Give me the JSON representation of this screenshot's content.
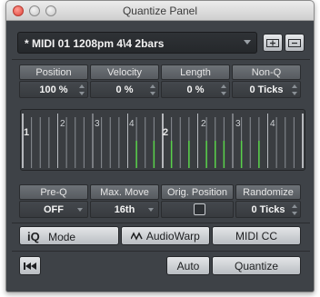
{
  "window": {
    "title": "Quantize Panel"
  },
  "preset": {
    "value": "* MIDI 01  1208pm  4\\4  2bars"
  },
  "params_top": [
    {
      "label": "Position",
      "value": "100 %"
    },
    {
      "label": "Velocity",
      "value": "0 %"
    },
    {
      "label": "Length",
      "value": "0 %"
    },
    {
      "label": "Non-Q",
      "value": "0 Ticks"
    }
  ],
  "grid": {
    "bar_labels": [
      "1",
      "2"
    ],
    "beat_labels": [
      "2",
      "3",
      "4",
      "2",
      "3",
      "4"
    ],
    "note_color": "#59d24a"
  },
  "params_bottom": [
    {
      "label": "Pre-Q",
      "value": "OFF"
    },
    {
      "label": "Max. Move",
      "value": "16th"
    },
    {
      "label": "Orig. Position",
      "checked": false
    },
    {
      "label": "Randomize",
      "value": "0 Ticks"
    }
  ],
  "modes": {
    "iq_prefix": "iQ",
    "iq_label": "Mode",
    "audiowarp_label": "AudioWarp",
    "midicc_label": "MIDI CC"
  },
  "actions": {
    "auto_label": "Auto",
    "quantize_label": "Quantize"
  }
}
